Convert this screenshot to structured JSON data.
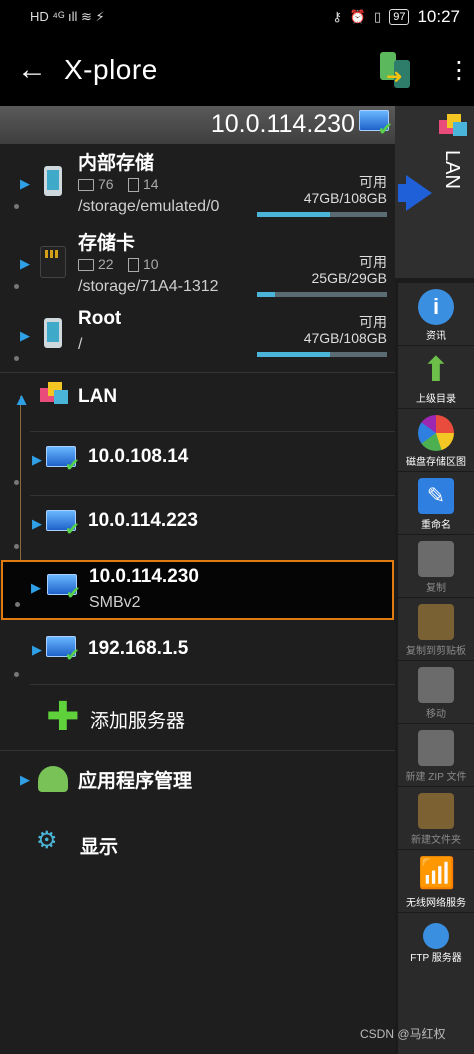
{
  "status": {
    "left_icons": "HD ⁴ᴳ ıll ≋ ⚡",
    "battery": "97",
    "time": "10:27"
  },
  "app": {
    "back": "←",
    "title": "X-plore",
    "menu": "⋮"
  },
  "pathbar": {
    "path": "10.0.114.230"
  },
  "storage": [
    {
      "name": "内部存储",
      "folders": "76",
      "files": "14",
      "path": "/storage/emulated/0",
      "avail": "可用",
      "size": "47GB/108GB",
      "fill": 0.56
    },
    {
      "name": "存储卡",
      "folders": "22",
      "files": "10",
      "path": "/storage/71A4-1312",
      "avail": "可用",
      "size": "25GB/29GB",
      "fill": 0.14
    },
    {
      "name": "Root",
      "path": "/",
      "avail": "可用",
      "size": "47GB/108GB",
      "fill": 0.56
    }
  ],
  "lan": {
    "label": "LAN",
    "servers": [
      {
        "name": "10.0.108.14"
      },
      {
        "name": "10.0.114.223"
      },
      {
        "name": "10.0.114.230",
        "proto": "SMBv2"
      },
      {
        "name": "192.168.1.5"
      }
    ],
    "add": "添加服务器"
  },
  "apps": "应用程序管理",
  "display": "显示",
  "side_panel": "LAN",
  "tools": [
    {
      "label": "资讯",
      "icon": "info-icon",
      "color": "#3a8fe0"
    },
    {
      "label": "上级目录",
      "icon": "up-arrow-icon",
      "color": "#6cc04a"
    },
    {
      "label": "磁盘存储区图",
      "icon": "pie-chart-icon",
      "color": "#ffffff"
    },
    {
      "label": "重命名",
      "icon": "pencil-icon",
      "color": "#2f7fe0"
    },
    {
      "label": "复制",
      "icon": "copy-icon",
      "color": "#cccccc"
    },
    {
      "label": "复制到剪贴板",
      "icon": "clipboard-icon",
      "color": "#d9a441"
    },
    {
      "label": "移动",
      "icon": "move-icon",
      "color": "#cccccc"
    },
    {
      "label": "新建 ZIP 文件",
      "icon": "zip-icon",
      "color": "#cccccc"
    },
    {
      "label": "新建文件夹",
      "icon": "new-folder-icon",
      "color": "#e0a53c"
    },
    {
      "label": "无线网络服务",
      "icon": "wifi-icon",
      "color": "#3a8fe0"
    },
    {
      "label": "FTP 服务器",
      "icon": "ftp-icon",
      "color": "#3a8fe0"
    }
  ],
  "watermark": "CSDN @马红权"
}
